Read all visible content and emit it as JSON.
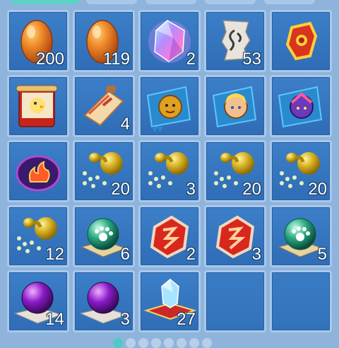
{
  "inventory": {
    "slots": [
      {
        "icon": "orange-egg-icon",
        "count": "200"
      },
      {
        "icon": "orange-egg-icon",
        "count": "119"
      },
      {
        "icon": "rainbow-crystal-icon",
        "count": "2"
      },
      {
        "icon": "scroll-fragment-icon",
        "count": "53"
      },
      {
        "icon": "red-gold-artifact-icon",
        "count": ""
      },
      {
        "icon": "chick-banner-scroll-icon",
        "count": ""
      },
      {
        "icon": "cream-paint-scroll-icon",
        "count": "4"
      },
      {
        "icon": "lion-hero-banner-icon",
        "count": ""
      },
      {
        "icon": "blonde-hero-banner-icon",
        "count": ""
      },
      {
        "icon": "purple-hero-banner-icon",
        "count": ""
      },
      {
        "icon": "flame-crest-icon",
        "count": ""
      },
      {
        "icon": "golden-gourd-icon",
        "count": "20"
      },
      {
        "icon": "golden-gourd-icon",
        "count": "3"
      },
      {
        "icon": "golden-gourd-icon",
        "count": "20"
      },
      {
        "icon": "golden-gourd-icon",
        "count": "20"
      },
      {
        "icon": "golden-gourd-icon",
        "count": "12"
      },
      {
        "icon": "green-paw-orb-icon",
        "count": "6"
      },
      {
        "icon": "red-rune-stone-icon",
        "count": "2"
      },
      {
        "icon": "red-rune-stone-icon",
        "count": "3"
      },
      {
        "icon": "green-paw-orb-icon",
        "count": "5"
      },
      {
        "icon": "purple-orb-icon",
        "count": "14"
      },
      {
        "icon": "purple-orb-icon",
        "count": "3"
      },
      {
        "icon": "crystal-carpet-icon",
        "count": "27"
      },
      {
        "icon": "",
        "count": ""
      },
      {
        "icon": "",
        "count": ""
      }
    ]
  },
  "colors": {
    "slot": "#3a7cc4",
    "slot_border": "#a8c8ec",
    "background": "#8fb4dc",
    "tab_active": "#5ed2c8"
  }
}
